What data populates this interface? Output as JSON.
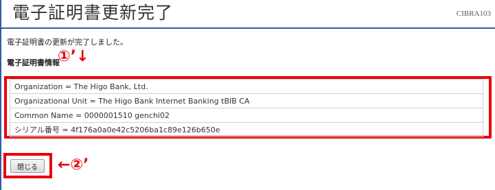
{
  "header": {
    "title": "電子証明書更新完了",
    "screen_id": "CIBRA103"
  },
  "message": "電子証明書の更新が完了しました。",
  "section": {
    "title": "電子証明書情報"
  },
  "certificate_info": {
    "rows": [
      "Organization = The Higo Bank, Ltd.",
      "Organizational Unit = The Higo Bank Internet Banking tBIB CA",
      "Common Name = 0000001510 genchi02",
      "シリアル番号 = 4f176a0a0e42c5206ba1c89e126b650e"
    ]
  },
  "actions": {
    "close_label": "閉じる"
  },
  "annotations": {
    "one": "①’↓",
    "two": "←②’"
  },
  "colors": {
    "accent_blue": "#2f5ea0",
    "annotation_red": "#e8000b"
  }
}
